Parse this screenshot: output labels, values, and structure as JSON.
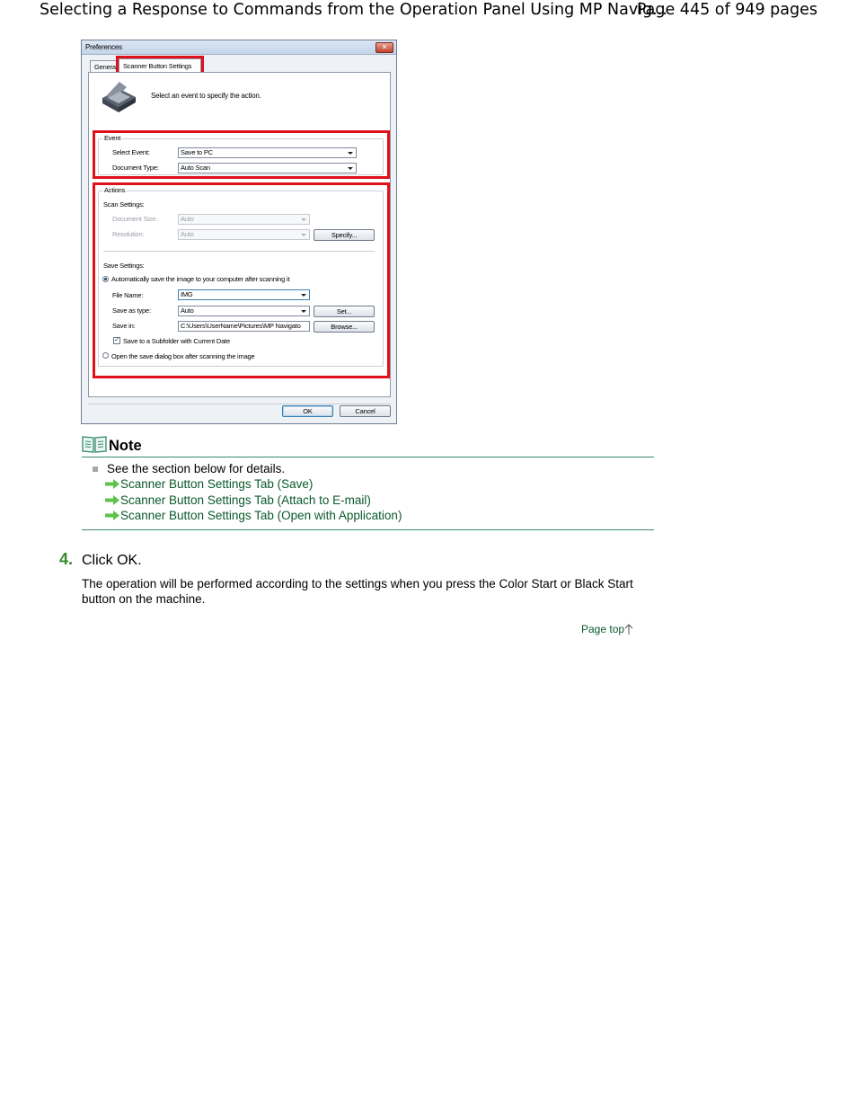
{
  "header": {
    "title": "Selecting a Response to Commands from the Operation Panel Using MP Navig...",
    "page_info": "Page 445 of 949 pages"
  },
  "dialog": {
    "title": "Preferences",
    "close_label": "✕",
    "tabs": [
      {
        "label": "General"
      },
      {
        "label": "Scanner Button Settings"
      }
    ],
    "hint": "Select an event to specify the action.",
    "event_group": {
      "label": "Event",
      "select_event_label": "Select Event:",
      "select_event_value": "Save to PC",
      "document_type_label": "Document Type:",
      "document_type_value": "Auto Scan"
    },
    "actions_group": {
      "label": "Actions",
      "scan_settings_label": "Scan Settings:",
      "document_size_label": "Document Size:",
      "document_size_value": "Auto",
      "resolution_label": "Resolution:",
      "resolution_value": "Auto",
      "specify_label": "Specify...",
      "save_settings_label": "Save Settings:",
      "auto_save_label": "Automatically save the image to your computer after scanning it",
      "file_name_label": "File Name:",
      "file_name_value": "IMG",
      "save_as_type_label": "Save as type:",
      "save_as_type_value": "Auto",
      "set_label": "Set...",
      "save_in_label": "Save in:",
      "save_in_value": "C:\\Users\\UserName\\Pictures\\MP Navigato",
      "browse_label": "Browse...",
      "subfolder_label": "Save to a Subfolder with Current Date",
      "open_dialog_label": "Open the save dialog box after scanning the image"
    },
    "ok_label": "OK",
    "cancel_label": "Cancel"
  },
  "note": {
    "title": "Note",
    "text": "See the section below for details.",
    "links": [
      {
        "label": "Scanner Button Settings Tab (Save)"
      },
      {
        "label": "Scanner Button Settings Tab (Attach to E-mail)"
      },
      {
        "label": "Scanner Button Settings Tab (Open with Application)"
      }
    ]
  },
  "step": {
    "number": "4.",
    "title": "Click OK.",
    "body": "The operation will be performed according to the settings when you press the Color Start or Black Start button on the machine."
  },
  "page_top_label": "Page top"
}
